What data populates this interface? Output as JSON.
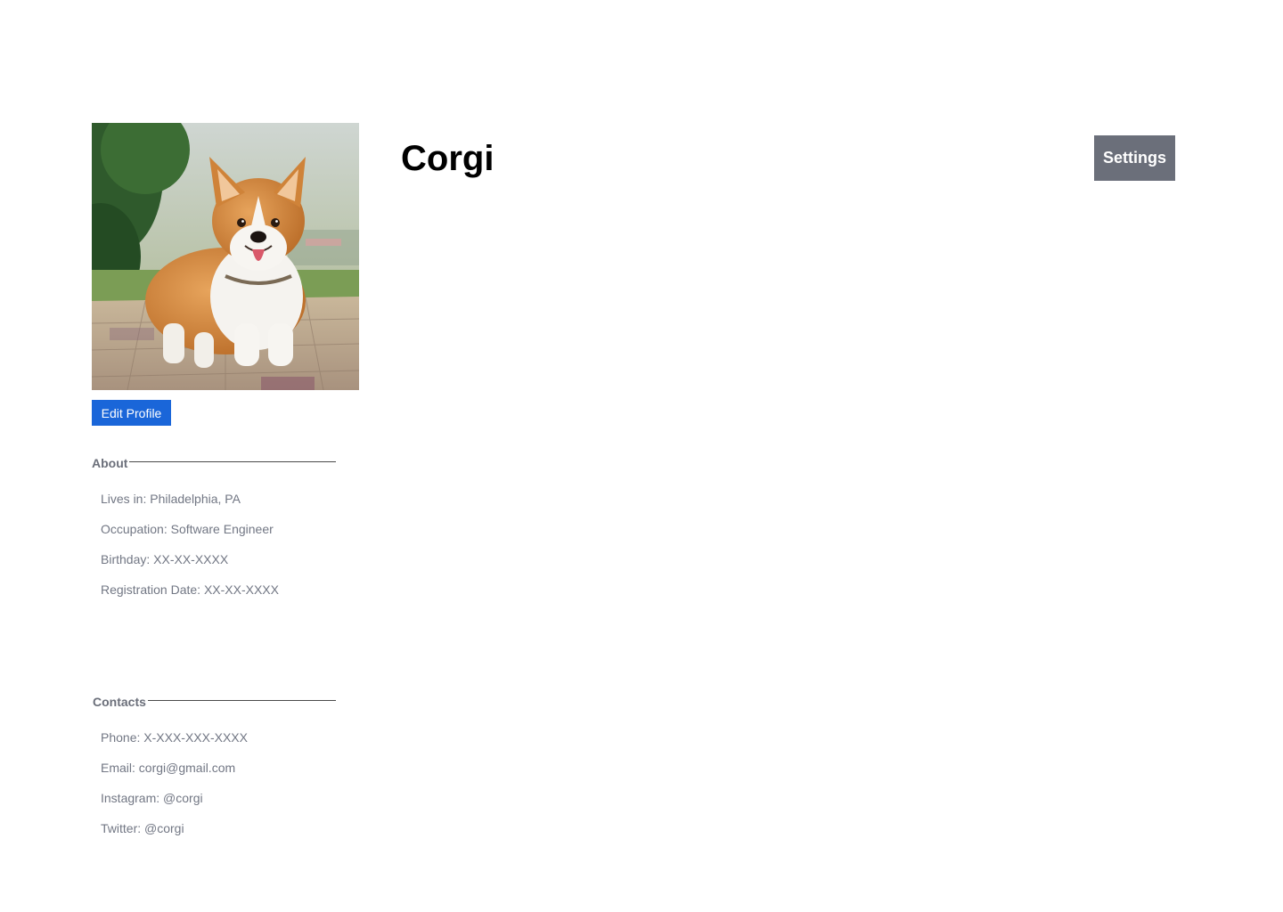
{
  "profile": {
    "name": "Corgi",
    "photo_icon": "corgi-dog-photo",
    "edit_label": "Edit Profile",
    "settings_label": "Settings"
  },
  "about": {
    "heading": "About",
    "items": [
      "Lives in: Philadelphia, PA",
      "Occupation: Software Engineer",
      "Birthday: XX-XX-XXXX",
      "Registration Date: XX-XX-XXXX"
    ]
  },
  "contacts": {
    "heading": "Contacts",
    "items": [
      "Phone: X-XXX-XXX-XXXX",
      "Email: corgi@gmail.com",
      "Instagram: @corgi",
      "Twitter: @corgi"
    ]
  },
  "colors": {
    "accent": "#1a66d9",
    "settings_bg": "#6b6f7a",
    "text_muted": "#727784"
  }
}
